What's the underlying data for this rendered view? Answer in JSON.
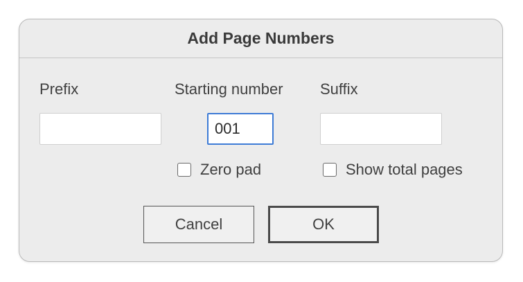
{
  "dialog": {
    "title": "Add Page Numbers"
  },
  "fields": {
    "prefix": {
      "label": "Prefix",
      "value": ""
    },
    "starting_number": {
      "label": "Starting number",
      "value": "001"
    },
    "suffix": {
      "label": "Suffix",
      "value": ""
    }
  },
  "options": {
    "zero_pad": {
      "label": "Zero pad",
      "checked": false
    },
    "show_total_pages": {
      "label": "Show total pages",
      "checked": false
    }
  },
  "buttons": {
    "cancel_label": "Cancel",
    "ok_label": "OK"
  },
  "colors": {
    "dialog_background": "#ececec",
    "focus_ring": "#3d7bd6"
  }
}
